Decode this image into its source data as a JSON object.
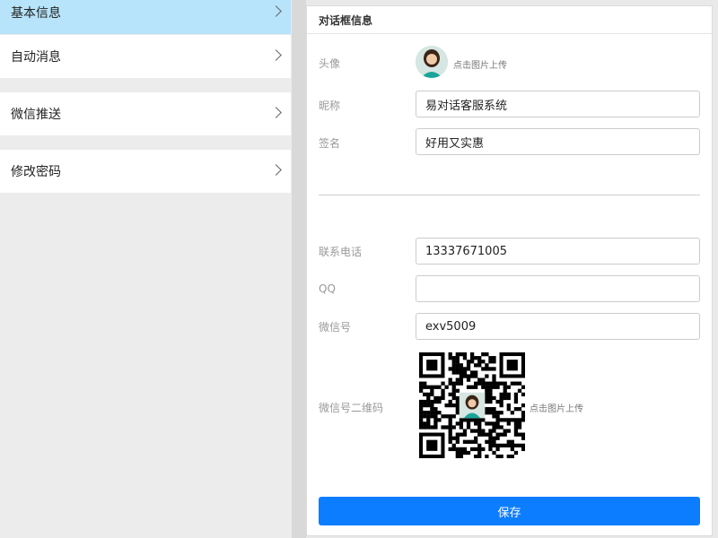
{
  "sidebar": {
    "items": [
      {
        "label": "基本信息",
        "active": true
      },
      {
        "label": "自动消息",
        "active": false
      },
      {
        "label": "微信推送",
        "active": false
      },
      {
        "label": "修改密码",
        "active": false
      }
    ]
  },
  "panel": {
    "title": "对话框信息",
    "avatar_label": "头像",
    "upload_hint": "点击图片上传",
    "nickname_label": "昵称",
    "nickname_value": "易对话客服系统",
    "signature_label": "签名",
    "signature_value": "好用又实惠",
    "phone_label": "联系电话",
    "phone_value": "13337671005",
    "qq_label": "QQ",
    "qq_value": "",
    "wechat_label": "微信号",
    "wechat_value": "exv5009",
    "wechat_qr_label": "微信号二维码",
    "qr_upload_hint": "点击图片上传",
    "save_label": "保存"
  },
  "colors": {
    "accent": "#0d7dff",
    "active_menu": "#b7e4fb"
  },
  "icons": {
    "menu_chevron": "chevron-right-icon"
  }
}
